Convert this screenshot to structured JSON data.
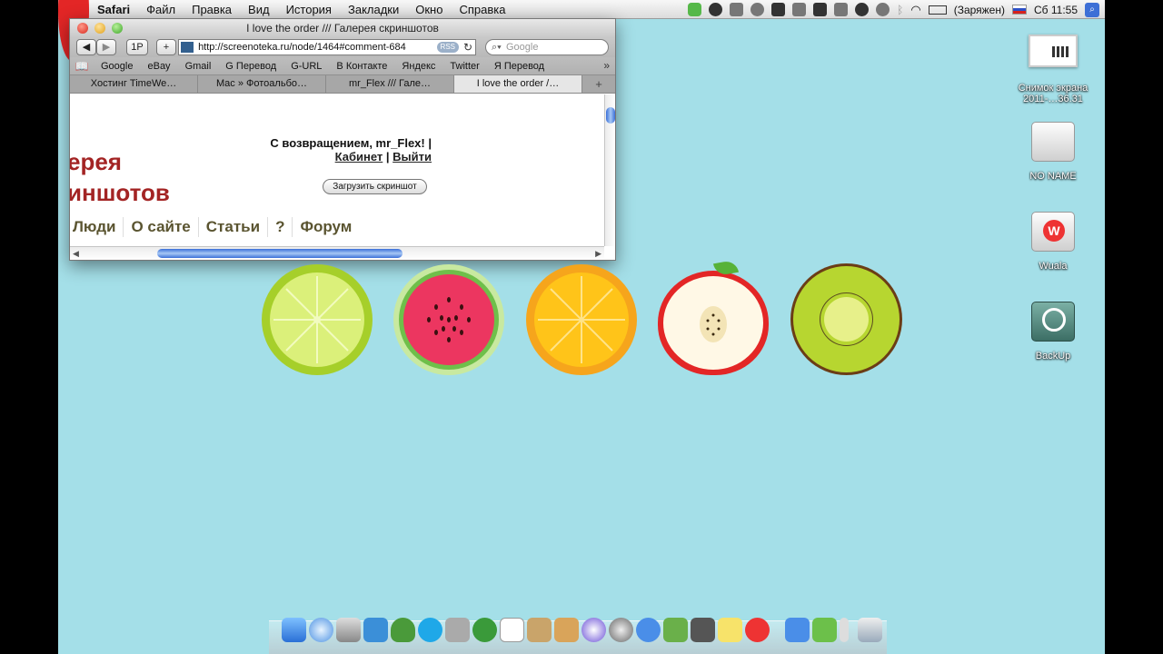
{
  "menubar": {
    "app_name": "Safari",
    "items": [
      "Файл",
      "Правка",
      "Вид",
      "История",
      "Закладки",
      "Окно",
      "Справка"
    ],
    "battery_label": "(Заряжен)",
    "clock": "Сб 11:55"
  },
  "safari": {
    "window_title": "I love the order /// Галерея скриншотов",
    "toolbar": {
      "reader_label": "1P",
      "add_label": "+"
    },
    "address": {
      "url": "http://screenoteka.ru/node/1464#comment-684",
      "rss_label": "RSS"
    },
    "search": {
      "placeholder": "Google"
    },
    "bookmarks": [
      "Google",
      "eBay",
      "Gmail",
      "G Перевод",
      "G-URL",
      "В Контакте",
      "Яндекс",
      "Twitter",
      "Я Перевод"
    ],
    "tabs": [
      {
        "label": "Хостинг TimeWe…",
        "active": false
      },
      {
        "label": "Mac » Фотоальбо…",
        "active": false
      },
      {
        "label": "mr_Flex /// Гале…",
        "active": false
      },
      {
        "label": "I love the order /…",
        "active": true
      }
    ],
    "page": {
      "site_title_line1": "ерея",
      "site_title_line2": "иншотов",
      "welcome": "С возвращением, mr_Flex! |",
      "cabinet_link": "Кабинет",
      "separator": "|",
      "logout_link": "Выйти",
      "upload_button": "Загрузить скриншот",
      "nav": [
        "Люди",
        "О сайте",
        "Статьи",
        "?",
        "Форум"
      ]
    }
  },
  "desktop": {
    "icons": [
      {
        "label_line1": "Снимок экрана",
        "label_line2": "2011-…36.31"
      },
      {
        "label_line1": "NO NAME",
        "label_line2": ""
      },
      {
        "label_line1": "Wuala",
        "label_line2": ""
      },
      {
        "label_line1": "BackUp",
        "label_line2": ""
      }
    ],
    "wallpaper_color": "#a4dfe8"
  },
  "dock": {
    "icons": [
      "finder",
      "safari",
      "mail",
      "twitter",
      "adium",
      "skype",
      "facetime",
      "utorrent",
      "calendar",
      "address-book",
      "package",
      "itunes",
      "disk-utility",
      "app-store",
      "system",
      "boot-camp",
      "stickies",
      "wuala",
      "app-store-folder",
      "stack",
      "utilities",
      "trash"
    ]
  }
}
